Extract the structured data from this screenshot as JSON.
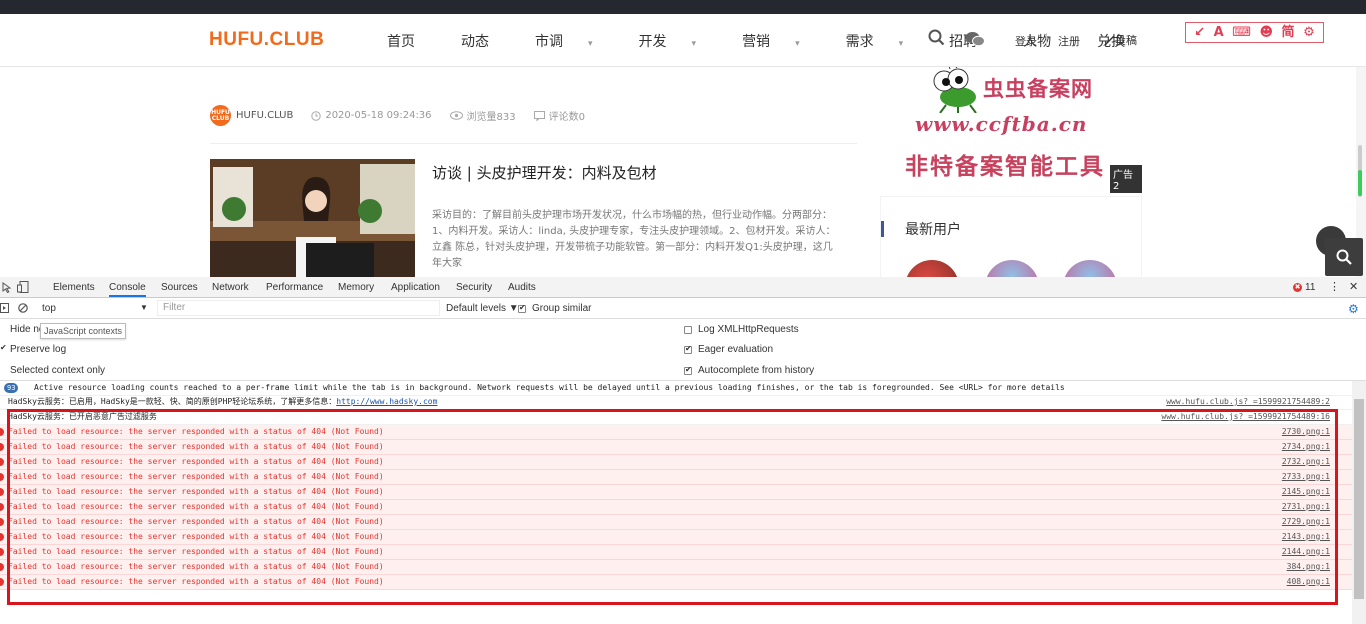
{
  "site": {
    "logo": "HUFU.CLUB",
    "menu": [
      "首页",
      "动态",
      "市调",
      "开发",
      "营销",
      "需求",
      "招聘",
      "人物",
      "兑换"
    ],
    "menu_with_caret": [
      false,
      false,
      true,
      true,
      true,
      true,
      false,
      false,
      false
    ],
    "login": "登录",
    "register": "注册",
    "post": "投稿",
    "tools": [
      "A",
      "简"
    ]
  },
  "article_meta": {
    "avatar_text": "HUFU CLUB",
    "author": "HUFU.CLUB",
    "date": "2020-05-18 09:24:36",
    "views": "浏览量833",
    "comments": "评论数0"
  },
  "article": {
    "title": "访谈 | 头皮护理开发：内料及包材",
    "excerpt": "采访目的：了解目前头皮护理市场开发状况，什么市场幅的热，但行业动作幅。分两部分：1、内料开发。采访人：linda, 头皮护理专家，专注头皮护理领域。2、包材开发。采访人：立鑫 陈总，针对头皮护理，开发带梳子功能软管。第一部分：内料开发Q1:头皮护理，这几年大家"
  },
  "ad": {
    "line1": "虫虫备案网",
    "line2": "www.ccftba.cn",
    "line3": "非特备案智能工具",
    "badge": "广告2"
  },
  "sidebar": {
    "new_users_title": "最新用户"
  },
  "devtools": {
    "tabs": [
      "Elements",
      "Console",
      "Sources",
      "Network",
      "Performance",
      "Memory",
      "Application",
      "Security",
      "Audits"
    ],
    "active_tab": "Console",
    "error_count": "11",
    "context": "top",
    "filter_placeholder": "Filter",
    "levels": "Default levels ▼",
    "group_similar": "Group similar",
    "settings_left": [
      "Hide network",
      "Preserve log",
      "Selected context only"
    ],
    "settings_left_checked": [
      false,
      true,
      false
    ],
    "settings_right": [
      "Log XMLHttpRequests",
      "Eager evaluation",
      "Autocomplete from history"
    ],
    "settings_right_checked": [
      false,
      true,
      true
    ],
    "tooltip": "JavaScript contexts",
    "messages": [
      {
        "type": "info",
        "count": "93",
        "text": "Active resource loading counts reached to a per-frame limit while the tab is in background. Network requests will be delayed until a previous loading finishes, or the tab is foregrounded. See <URL> for more details",
        "src": ""
      },
      {
        "type": "info",
        "text": "HadSky云服务：已启用，HadSky是一款轻、快、简的原创PHP轻论坛系统，了解更多信息：",
        "link": "http://www.hadsky.com",
        "src": "www.hufu.club.js?_=1599921754489:2"
      },
      {
        "type": "info",
        "text": "HadSky云服务：已开启恶意广告过滤服务",
        "src": "www.hufu.club.js?_=1599921754489:16"
      },
      {
        "type": "err",
        "text": "Failed to load resource: the server responded with a status of 404 (Not Found)",
        "src": "2730.png:1"
      },
      {
        "type": "err",
        "text": "Failed to load resource: the server responded with a status of 404 (Not Found)",
        "src": "2734.png:1"
      },
      {
        "type": "err",
        "text": "Failed to load resource: the server responded with a status of 404 (Not Found)",
        "src": "2732.png:1"
      },
      {
        "type": "err",
        "text": "Failed to load resource: the server responded with a status of 404 (Not Found)",
        "src": "2733.png:1"
      },
      {
        "type": "err",
        "text": "Failed to load resource: the server responded with a status of 404 (Not Found)",
        "src": "2145.png:1"
      },
      {
        "type": "err",
        "text": "Failed to load resource: the server responded with a status of 404 (Not Found)",
        "src": "2731.png:1"
      },
      {
        "type": "err",
        "text": "Failed to load resource: the server responded with a status of 404 (Not Found)",
        "src": "2729.png:1"
      },
      {
        "type": "err",
        "text": "Failed to load resource: the server responded with a status of 404 (Not Found)",
        "src": "2143.png:1"
      },
      {
        "type": "err",
        "text": "Failed to load resource: the server responded with a status of 404 (Not Found)",
        "src": "2144.png:1"
      },
      {
        "type": "err",
        "text": "Failed to load resource: the server responded with a status of 404 (Not Found)",
        "src": "384.png:1"
      },
      {
        "type": "err",
        "text": "Failed to load resource: the server responded with a status of 404 (Not Found)",
        "src": "408.png:1"
      }
    ]
  },
  "colors": {
    "brand": "#f26a1b",
    "error": "#e3342f",
    "highlight": "#d8141f",
    "ad": "#c74060"
  }
}
